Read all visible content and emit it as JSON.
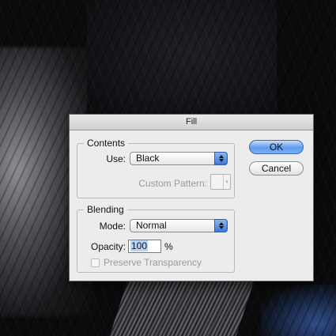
{
  "dialog": {
    "title": "Fill",
    "contents": {
      "legend": "Contents",
      "use_label": "Use:",
      "use_value": "Black",
      "custom_pattern_label": "Custom Pattern:"
    },
    "blending": {
      "legend": "Blending",
      "mode_label": "Mode:",
      "mode_value": "Normal",
      "opacity_label": "Opacity:",
      "opacity_value": "100",
      "opacity_unit": "%",
      "preserve_label": "Preserve Transparency"
    },
    "buttons": {
      "ok": "OK",
      "cancel": "Cancel"
    }
  },
  "colors": {
    "accent": "#3b78d8",
    "dialog_bg": "#ececec"
  }
}
